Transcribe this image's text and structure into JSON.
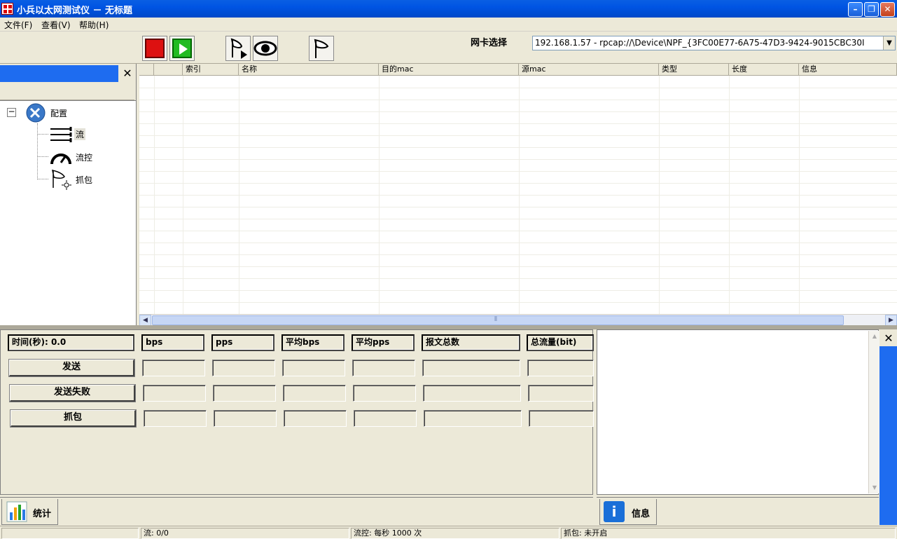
{
  "window": {
    "title": "小兵以太网测试仪 － 无标题",
    "min": "–",
    "max": "❐",
    "close": "✕"
  },
  "menu": [
    "文件(F)",
    "查看(V)",
    "帮助(H)"
  ],
  "toolbar": {
    "nic_label": "网卡选择",
    "nic_value": "192.168.1.57 - rpcap://\\Device\\NPF_{3FC00E77-6A75-47D3-9424-9015CBC30I",
    "nic_arrow": "▼"
  },
  "left_panel": {
    "close": "✕",
    "tree": {
      "toggle": "−",
      "root": "配置",
      "children": [
        "流",
        "流控",
        "抓包"
      ]
    }
  },
  "grid": {
    "columns": [
      "",
      "",
      "索引",
      "名称",
      "目的mac",
      "源mac",
      "类型",
      "长度",
      "信息"
    ]
  },
  "hscroll": {
    "left": "◀",
    "right": "▶",
    "grip": "⦀"
  },
  "stats": {
    "headers": [
      "时间(秒): 0.0",
      "bps",
      "pps",
      "平均bps",
      "平均pps",
      "报文总数",
      "总流量(bit)"
    ],
    "rows": [
      "发送",
      "发送失败",
      "抓包"
    ]
  },
  "info_panel": {
    "close": "✕",
    "scroll_up": "▲",
    "scroll_down": "▼"
  },
  "tabs": {
    "stats": "统计",
    "info": "信息",
    "info_icon": "i"
  },
  "status": {
    "cells": [
      "",
      "流: 0/0",
      "流控: 每秒 1000 次",
      "抓包: 未开启"
    ]
  }
}
